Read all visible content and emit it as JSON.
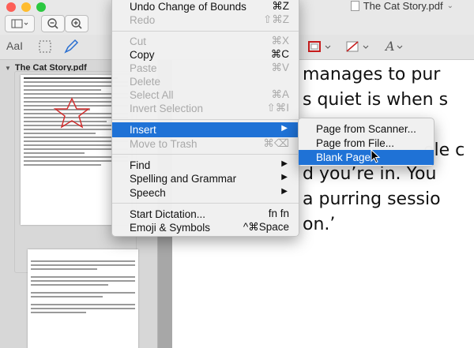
{
  "window": {
    "title": "The Cat Story.pdf",
    "title_suffix": "⌄"
  },
  "sidebar": {
    "header": "The Cat Story.pdf",
    "page_number": "1"
  },
  "edit_menu": {
    "items": [
      {
        "label": "Undo Change of Bounds",
        "shortcut": "⌘Z",
        "disabled": false
      },
      {
        "label": "Redo",
        "shortcut": "⇧⌘Z",
        "disabled": true
      },
      {
        "label": "Cut",
        "shortcut": "⌘X",
        "disabled": true
      },
      {
        "label": "Copy",
        "shortcut": "⌘C",
        "disabled": false
      },
      {
        "label": "Paste",
        "shortcut": "⌘V",
        "disabled": true
      },
      {
        "label": "Delete",
        "shortcut": "",
        "disabled": true
      },
      {
        "label": "Select All",
        "shortcut": "⌘A",
        "disabled": true
      },
      {
        "label": "Invert Selection",
        "shortcut": "⇧⌘I",
        "disabled": true
      },
      {
        "label": "Insert",
        "shortcut": "",
        "disabled": false,
        "highlighted": true,
        "submenu": true
      },
      {
        "label": "Move to Trash",
        "shortcut": "⌘⌫",
        "disabled": true
      },
      {
        "label": "Find",
        "shortcut": "",
        "submenu": true
      },
      {
        "label": "Spelling and Grammar",
        "shortcut": "",
        "submenu": true
      },
      {
        "label": "Speech",
        "shortcut": "",
        "submenu": true
      },
      {
        "label": "Start Dictation...",
        "shortcut": "fn fn"
      },
      {
        "label": "Emoji & Symbols",
        "shortcut": "^⌘Space"
      }
    ]
  },
  "insert_submenu": {
    "items": [
      {
        "label": "Page from Scanner..."
      },
      {
        "label": "Page from File..."
      },
      {
        "label": "Blank Page",
        "highlighted": true
      }
    ]
  },
  "document": {
    "lines": [
      "manages to pur",
      "s quiet is when s",
      "ole c",
      "d you’re in. You",
      "a purring sessio",
      "on.’"
    ]
  },
  "colors": {
    "highlight": "#1f72d6",
    "menu_bg": "#f0f0f0",
    "doc_bg": "#ffffff"
  }
}
